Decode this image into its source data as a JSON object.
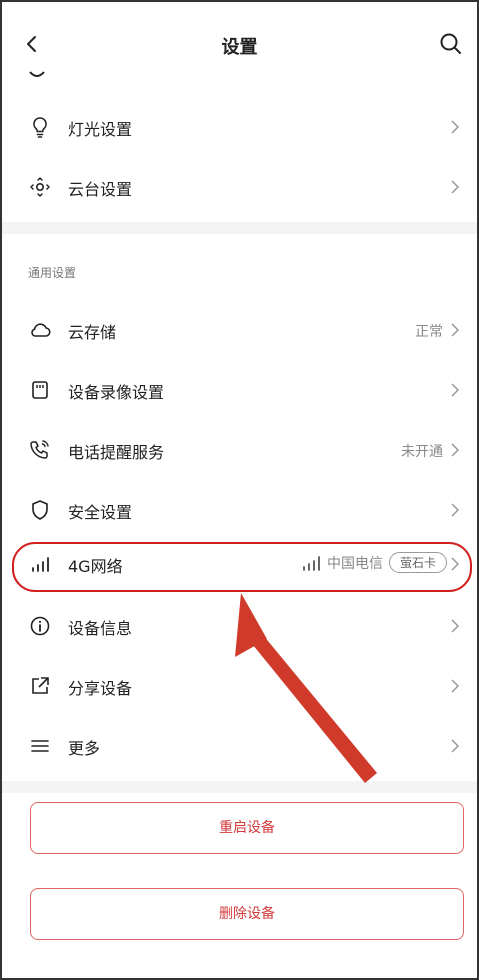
{
  "header": {
    "title": "设置"
  },
  "rows": {
    "light": {
      "label": "灯光设置"
    },
    "ptz": {
      "label": "云台设置"
    },
    "cloud": {
      "label": "云存储",
      "value": "正常"
    },
    "record": {
      "label": "设备录像设置"
    },
    "phone": {
      "label": "电话提醒服务",
      "value": "未开通"
    },
    "security": {
      "label": "安全设置"
    },
    "network": {
      "label": "4G网络",
      "carrier": "中国电信",
      "card": "萤石卡"
    },
    "info": {
      "label": "设备信息"
    },
    "share": {
      "label": "分享设备"
    },
    "more": {
      "label": "更多"
    }
  },
  "sections": {
    "general": "通用设置"
  },
  "buttons": {
    "restart": "重启设备",
    "delete": "删除设备"
  },
  "colors": {
    "accent": "#d23b3b",
    "highlight": "#d11e1e",
    "separator": "#f4f4f4"
  }
}
